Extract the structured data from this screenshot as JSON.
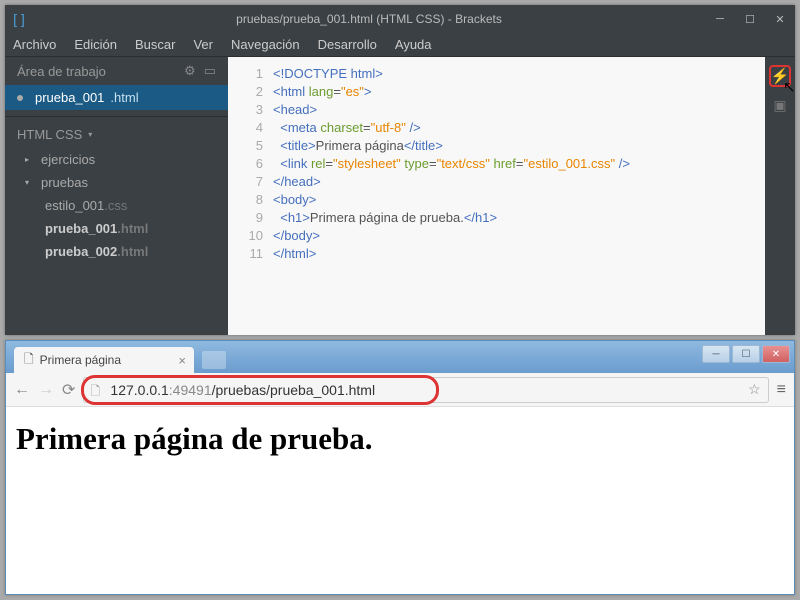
{
  "brackets": {
    "title": "pruebas/prueba_001.html (HTML CSS) - Brackets",
    "menu": [
      "Archivo",
      "Edición",
      "Buscar",
      "Ver",
      "Navegación",
      "Desarrollo",
      "Ayuda"
    ],
    "sidebar": {
      "working_label": "Área de trabajo",
      "working_file": {
        "name": "prueba_001",
        "ext": ".html"
      },
      "project_label": "HTML CSS",
      "folders": [
        {
          "name": "ejercicios",
          "expanded": false
        },
        {
          "name": "pruebas",
          "expanded": true,
          "files": [
            {
              "name": "estilo_001",
              "ext": ".css"
            },
            {
              "name": "prueba_001",
              "ext": ".html",
              "active": true
            },
            {
              "name": "prueba_002",
              "ext": ".html"
            }
          ]
        }
      ]
    },
    "code_lines": [
      "1",
      "2",
      "3",
      "4",
      "5",
      "6",
      "7",
      "8",
      "9",
      "10",
      "11"
    ]
  },
  "chrome": {
    "tab_title": "Primera página",
    "url_host": "127.0.0.1",
    "url_port": ":49491",
    "url_path": "/pruebas/prueba_001.html",
    "heading": "Primera página de prueba."
  }
}
